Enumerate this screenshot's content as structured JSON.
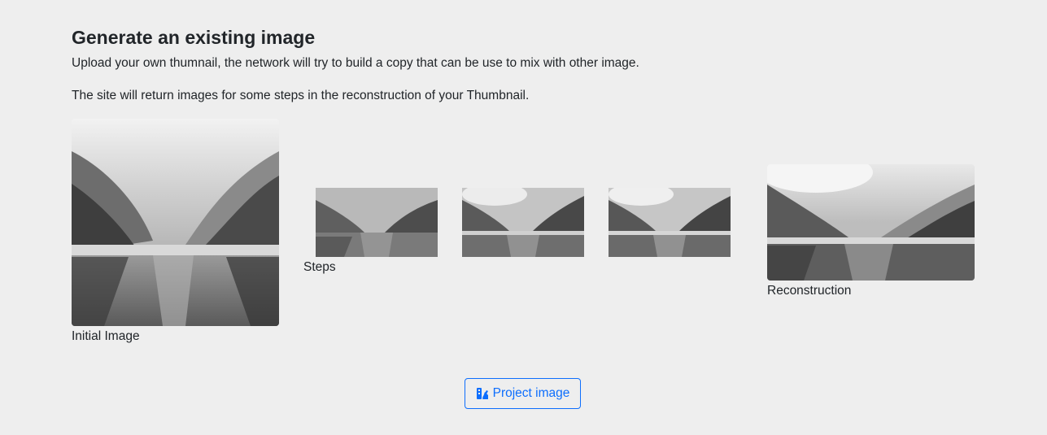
{
  "header": {
    "title": "Generate an existing image",
    "description_1": "Upload your own thumnail, the network will try to build a copy that can be use to mix with other image.",
    "description_2": "The site will return images for some steps in the reconstruction of your Thumbnail."
  },
  "images": {
    "initial_caption": "Initial Image",
    "steps_caption": "Steps",
    "reconstruction_caption": "Reconstruction"
  },
  "actions": {
    "project_button_label": "Project image",
    "project_button_icon": "images-icon",
    "accent_color": "#0d6efd"
  }
}
